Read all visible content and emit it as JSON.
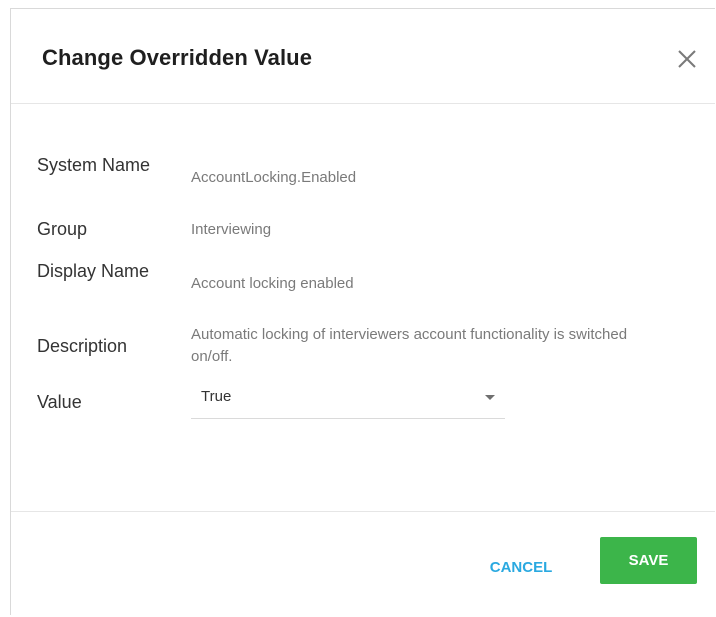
{
  "dialog": {
    "title": "Change Overridden Value",
    "close_icon": "close-icon"
  },
  "fields": {
    "system_name": {
      "label": "System Name",
      "value": "AccountLocking.Enabled"
    },
    "group": {
      "label": "Group",
      "value": "Interviewing"
    },
    "display_name": {
      "label": "Display Name",
      "value": "Account locking enabled"
    },
    "description": {
      "label": "Description",
      "value": "Automatic locking of interviewers account functionality is switched on/off."
    },
    "value": {
      "label": "Value",
      "selected": "True",
      "caret_icon": "caret-down-icon"
    }
  },
  "footer": {
    "cancel_label": "CANCEL",
    "save_label": "SAVE"
  },
  "colors": {
    "accent_blue": "#2aa9e0",
    "save_green": "#3cb54a",
    "title_text": "#1f1f1f",
    "value_text": "#7a7a7a"
  }
}
